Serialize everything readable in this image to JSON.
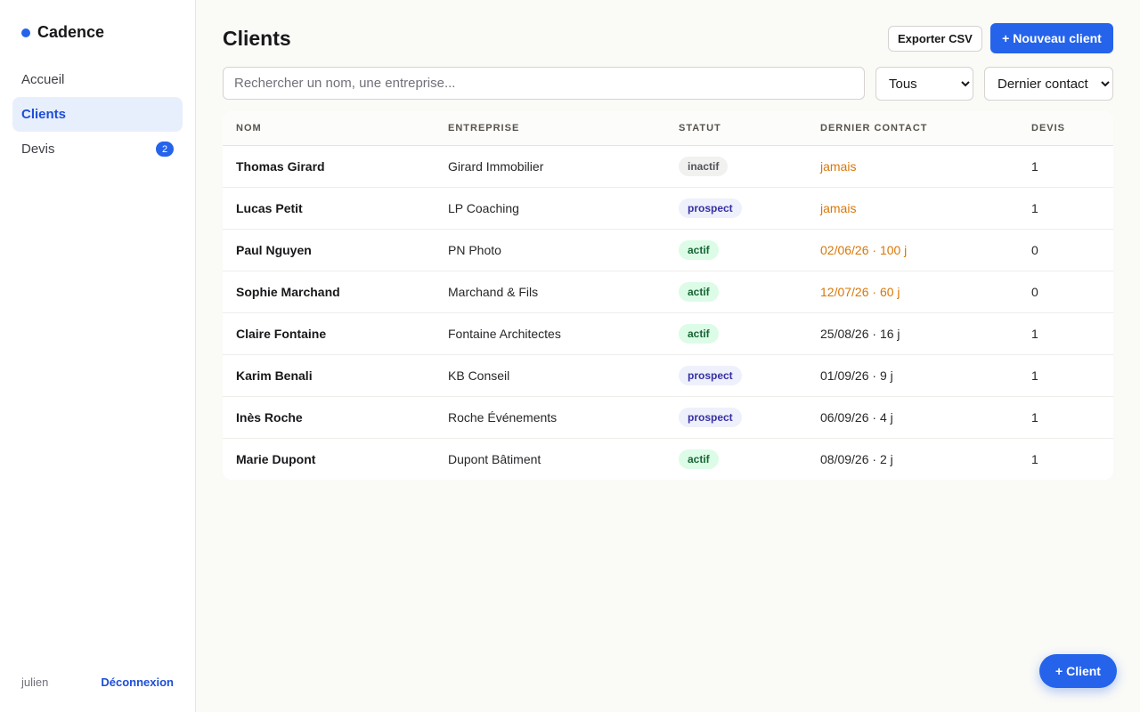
{
  "app": {
    "name": "Cadence"
  },
  "sidebar": {
    "items": [
      {
        "label": "Accueil",
        "active": false
      },
      {
        "label": "Clients",
        "active": true
      },
      {
        "label": "Devis",
        "active": false,
        "badge": "2"
      }
    ],
    "user": "julien",
    "logout_label": "Déconnexion"
  },
  "header": {
    "title": "Clients",
    "export_label": "Exporter CSV",
    "new_label": "+ Nouveau client"
  },
  "filters": {
    "search_placeholder": "Rechercher un nom, une entreprise...",
    "status_selected": "Tous",
    "sort_selected": "Dernier contact"
  },
  "table": {
    "columns": [
      "NOM",
      "ENTREPRISE",
      "STATUT",
      "DERNIER CONTACT",
      "DEVIS"
    ],
    "rows": [
      {
        "name": "Thomas Girard",
        "company": "Girard Immobilier",
        "status": "inactif",
        "last_contact": "jamais",
        "stale": true,
        "quotes": "1"
      },
      {
        "name": "Lucas Petit",
        "company": "LP Coaching",
        "status": "prospect",
        "last_contact": "jamais",
        "stale": true,
        "quotes": "1"
      },
      {
        "name": "Paul Nguyen",
        "company": "PN Photo",
        "status": "actif",
        "last_contact": "02/06/26 · 100 j",
        "stale": true,
        "quotes": "0"
      },
      {
        "name": "Sophie Marchand",
        "company": "Marchand & Fils",
        "status": "actif",
        "last_contact": "12/07/26 · 60 j",
        "stale": true,
        "quotes": "0"
      },
      {
        "name": "Claire Fontaine",
        "company": "Fontaine Architectes",
        "status": "actif",
        "last_contact": "25/08/26 · 16 j",
        "stale": false,
        "quotes": "1"
      },
      {
        "name": "Karim Benali",
        "company": "KB Conseil",
        "status": "prospect",
        "last_contact": "01/09/26 · 9 j",
        "stale": false,
        "quotes": "1"
      },
      {
        "name": "Inès Roche",
        "company": "Roche Événements",
        "status": "prospect",
        "last_contact": "06/09/26 · 4 j",
        "stale": false,
        "quotes": "1"
      },
      {
        "name": "Marie Dupont",
        "company": "Dupont Bâtiment",
        "status": "actif",
        "last_contact": "08/09/26 · 2 j",
        "stale": false,
        "quotes": "1"
      }
    ]
  },
  "fab_label": "+ Client",
  "colors": {
    "accent": "#2563eb",
    "stale": "#d97706",
    "active_bg": "#dcfce7",
    "prospect_bg": "#eef0fb"
  }
}
